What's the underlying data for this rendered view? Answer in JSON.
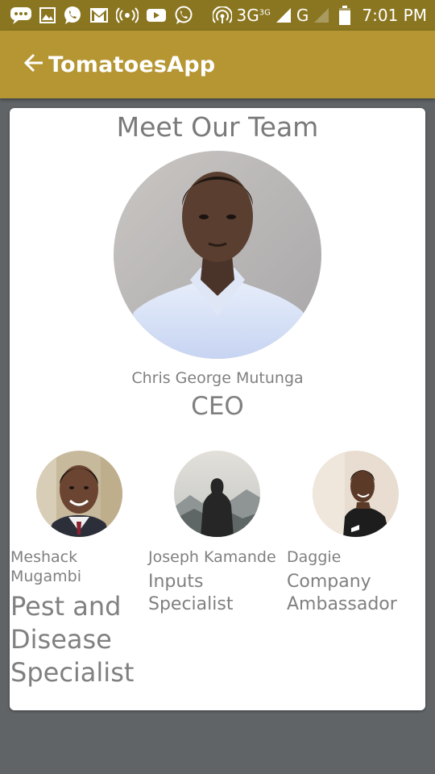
{
  "status_bar": {
    "network": "3G",
    "network_sup": "3G",
    "network2": "G",
    "time": "7:01 PM",
    "icons": [
      "chat-icon",
      "image-icon",
      "whatsapp-icon",
      "gmail-icon",
      "broadcast-icon",
      "youtube-icon",
      "whatsapp-icon",
      "hotspot-icon",
      "signal-icon",
      "battery-icon"
    ]
  },
  "app_bar": {
    "back_icon": "arrow-left-icon",
    "title": "TomatoesApp"
  },
  "team": {
    "heading": "Meet Our Team",
    "ceo": {
      "name": "Chris George Mutunga",
      "role": "CEO"
    },
    "members": [
      {
        "name": "Meshack Mugambi",
        "role": "Pest and Disease Specialist"
      },
      {
        "name": "Joseph Kamande",
        "role": "Inputs Specialist"
      },
      {
        "name": "Daggie",
        "role": "Company Ambassador"
      }
    ]
  },
  "colors": {
    "status_bar": "#8a7620",
    "app_bar": "#b59632",
    "background": "#606466",
    "card": "#ffffff",
    "text_gray": "#808080"
  }
}
